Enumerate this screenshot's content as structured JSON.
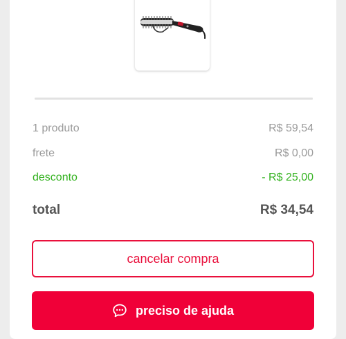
{
  "product": {
    "image_alt": "modelador de cachos"
  },
  "summary": {
    "items": [
      {
        "label": "1 produto",
        "value": "R$ 59,54"
      },
      {
        "label": "frete",
        "value": "R$ 0,00"
      },
      {
        "label": "desconto",
        "value": "- R$ 25,00"
      }
    ],
    "total": {
      "label": "total",
      "value": "R$ 34,54"
    }
  },
  "actions": {
    "cancel_label": "cancelar compra",
    "help_label": "preciso de ajuda",
    "help_icon": "chat-bubble-icon"
  },
  "colors": {
    "accent": "#f00038",
    "discount": "#33b21f"
  }
}
